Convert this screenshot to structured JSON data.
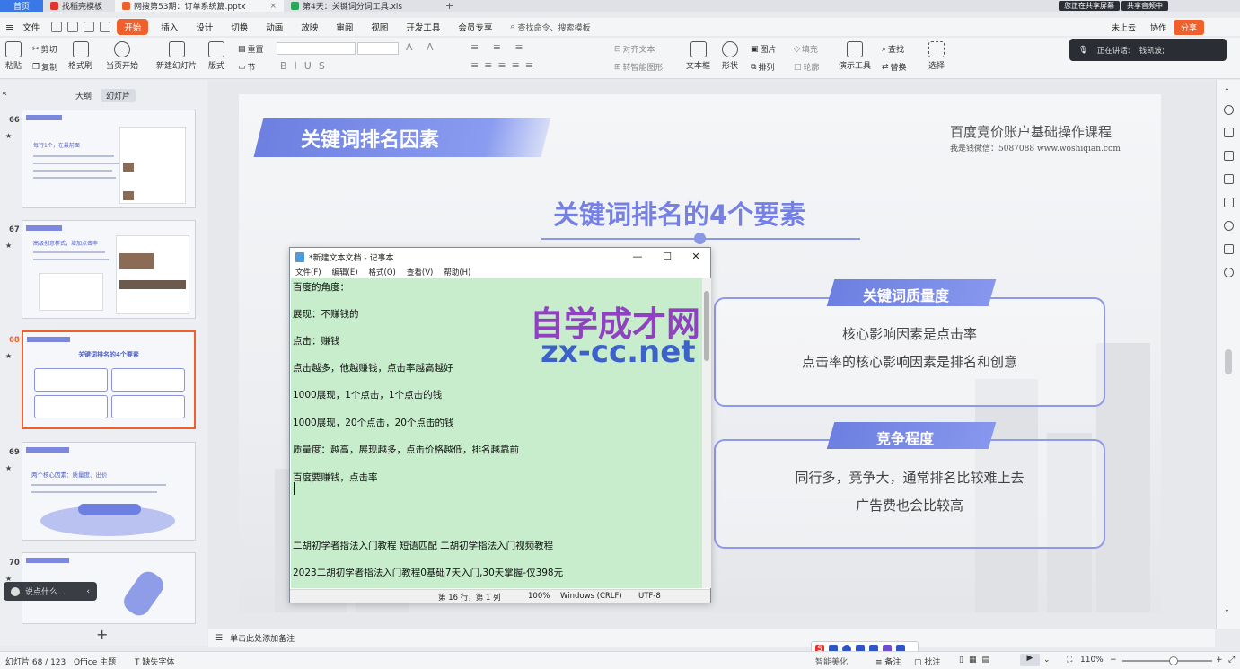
{
  "tabs": [
    {
      "label": "首页"
    },
    {
      "label": "找稻壳模板"
    },
    {
      "label": "网搜第53期：订单系统篇.pptx"
    },
    {
      "label": "第4天：关键词分词工具.xls"
    }
  ],
  "screen_share": {
    "sharing_label": "您正在共享屏幕",
    "audio_label": "共享音频中"
  },
  "menu": {
    "file": "文件",
    "items": [
      "开始",
      "插入",
      "设计",
      "切换",
      "动画",
      "放映",
      "审阅",
      "视图",
      "开发工具",
      "会员专享"
    ],
    "search_placeholder": "查找命令、搜索模板",
    "cloud": "未上云",
    "collab": "协作",
    "share": "分享"
  },
  "ribbon": {
    "paste": "粘贴",
    "cut": "剪切",
    "copy": "复制",
    "format_painter": "格式刷",
    "play_from_current": "当页开始",
    "new_slide": "新建幻灯片",
    "layout": "版式",
    "section": "节",
    "reset": "重置",
    "align_text": "对齐文本",
    "convert_smartart": "转智能图形",
    "textbox": "文本框",
    "shape": "形状",
    "picture": "图片",
    "arrange": "排列",
    "fill": "填充",
    "outline": "轮廓",
    "present_tools": "演示工具",
    "find": "查找",
    "replace": "替换",
    "select": "选择"
  },
  "speaker": {
    "label": "正在讲话:",
    "name": "钱凯波;"
  },
  "left_pane": {
    "tab_outline": "大纲",
    "tab_slides": "幻灯片",
    "slides": [
      {
        "num": "66",
        "star": "★",
        "title": "每行1个，在最前面"
      },
      {
        "num": "67",
        "star": "★",
        "title": "高级创意样式，增加点击率"
      },
      {
        "num": "68",
        "star": "★",
        "title": "关键词排名的4个要素"
      },
      {
        "num": "69",
        "star": "★",
        "title": "两个核心因素：质量度、出价"
      },
      {
        "num": "70",
        "star": "★",
        "title": ""
      }
    ],
    "add_slide": "+"
  },
  "slide": {
    "title": "关键词排名因素",
    "course": "百度竞价账户基础操作课程",
    "contact": "我是钱微信：5087088  www.woshiqian.com",
    "heading": "关键词排名的4个要素",
    "cards": [
      {
        "tag": "关键词质量度",
        "lines": [
          "核心影响因素是点击率",
          "点击率的核心影响因素是排名和创意"
        ]
      },
      {
        "tag": "竞争程度",
        "lines": [
          "同行多，竞争大，通常排名比较难上去",
          "广告费也会比较高"
        ]
      }
    ]
  },
  "notepad": {
    "title": "*新建文本文档 - 记事本",
    "menus": [
      "文件(F)",
      "编辑(E)",
      "格式(O)",
      "查看(V)",
      "帮助(H)"
    ],
    "lines": [
      "百度的角度：",
      "展现：不赚钱的",
      "点击：赚钱",
      "点击越多，他越赚钱，点击率越高越好",
      "1000展现，1个点击，1个点击的钱",
      "1000展现，20个点击，20个点击的钱",
      "质量度：越高，展现越多，点击价格越低，排名越靠前",
      "百度要赚钱，点击率",
      "二胡初学者指法入门教程  短语匹配 二胡初学指法入门视频教程",
      "2023二胡初学者指法入门教程0基础7天入门,30天掌握-仅398元"
    ],
    "status": {
      "position": "第 16 行，第 1 列",
      "zoom": "100%",
      "eol": "Windows (CRLF)",
      "encoding": "UTF-8"
    }
  },
  "watermark": {
    "line1": "自学成才网",
    "line2": "zx-cc.net"
  },
  "notes_placeholder": "单击此处添加备注",
  "comment_placeholder": "说点什么...",
  "statusbar": {
    "slide_counter": "幻灯片 68 / 123",
    "theme": "Office 主题",
    "missing_font": "缺失字体",
    "smart_beautify": "智能美化",
    "notes": "备注",
    "comments": "批注",
    "zoom": "110%"
  },
  "colors": {
    "accent": "#f0602c",
    "slide_primary": "#7480e3",
    "notepad_bg": "#c7edcc"
  }
}
